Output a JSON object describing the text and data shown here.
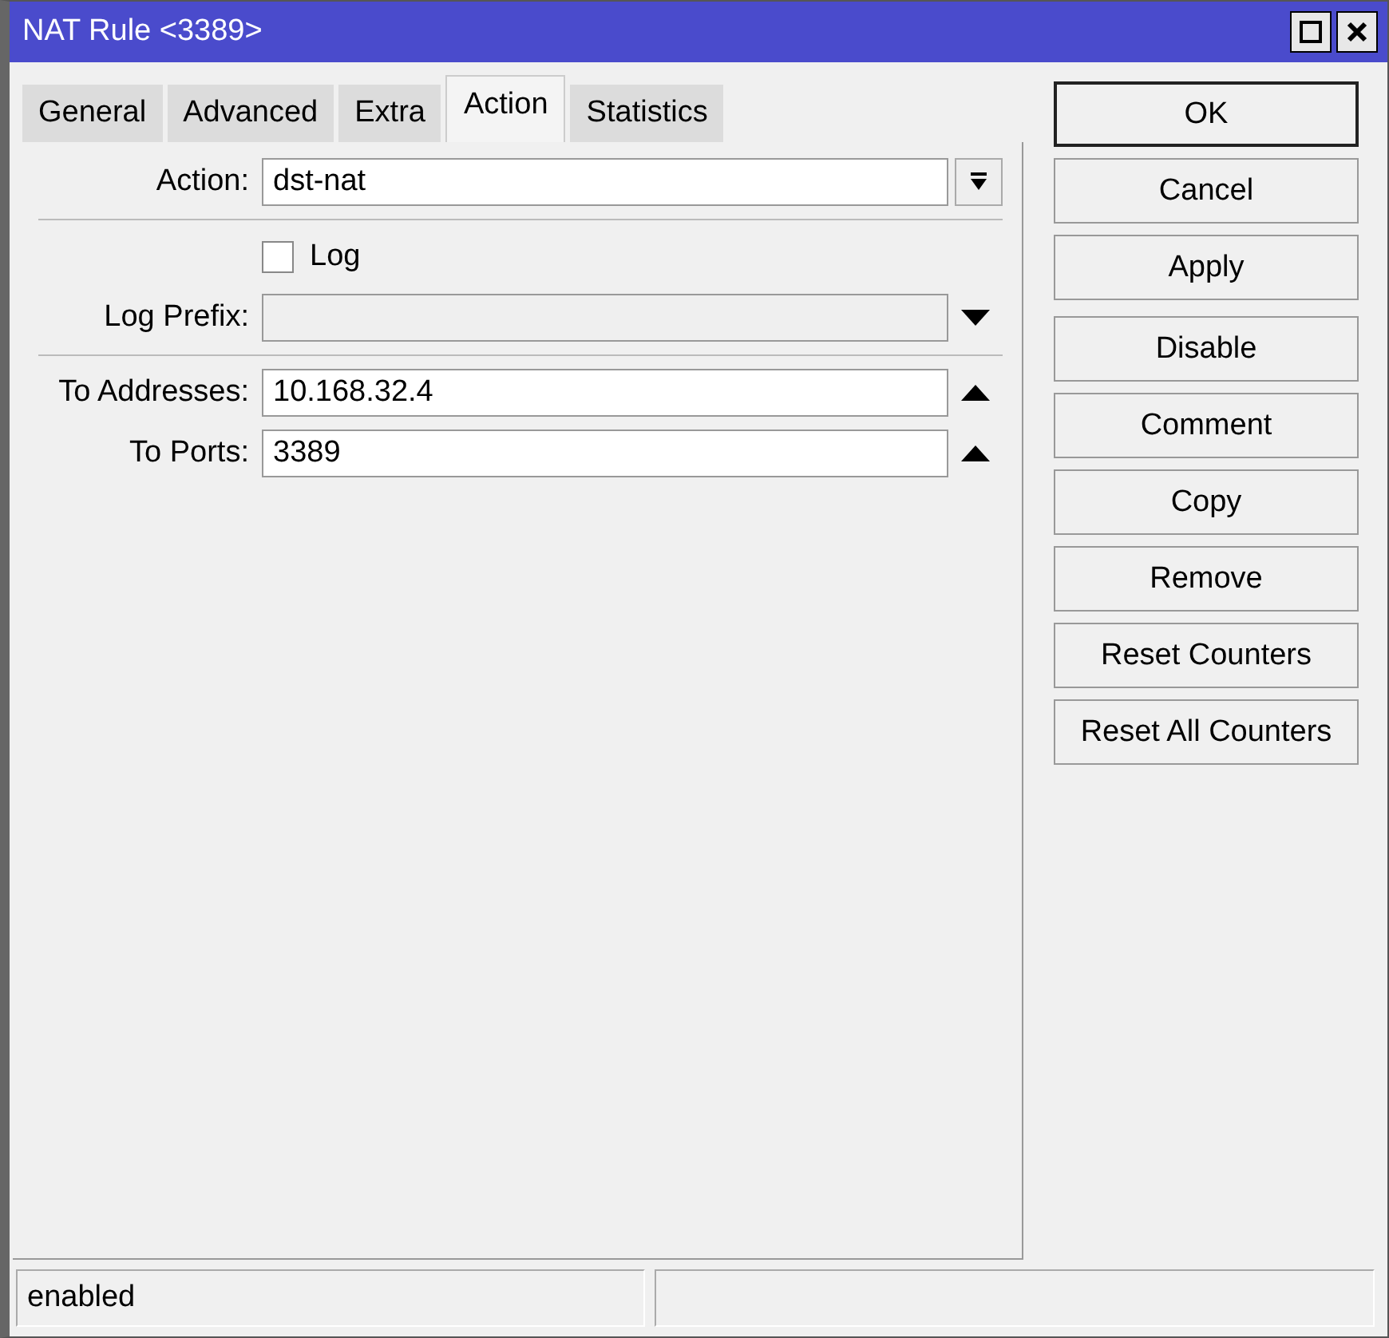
{
  "window": {
    "title": "NAT Rule <3389>"
  },
  "tabs": [
    {
      "label": "General",
      "selected": false
    },
    {
      "label": "Advanced",
      "selected": false
    },
    {
      "label": "Extra",
      "selected": false
    },
    {
      "label": "Action",
      "selected": true
    },
    {
      "label": "Statistics",
      "selected": false
    }
  ],
  "groups": [
    {
      "rows": [
        {
          "kind": "select",
          "label": "Action:",
          "value": "dst-nat"
        }
      ]
    },
    {
      "rows": [
        {
          "kind": "checkbox",
          "label": "Log",
          "checked": false
        },
        {
          "kind": "text",
          "label": "Log Prefix:",
          "disabled": true,
          "expanded": false
        }
      ]
    },
    {
      "rows": [
        {
          "kind": "text",
          "label": "To Addresses:",
          "value": "10.168.32.4",
          "disabled": false,
          "expanded": true
        },
        {
          "kind": "text",
          "label": "To Ports:",
          "value": "3389",
          "disabled": false,
          "expanded": true
        }
      ]
    }
  ],
  "button_groups": [
    [
      {
        "label": "OK",
        "default": true
      },
      {
        "label": "Cancel",
        "default": false
      },
      {
        "label": "Apply",
        "default": false
      }
    ],
    [
      {
        "label": "Disable",
        "default": false
      },
      {
        "label": "Comment",
        "default": false
      },
      {
        "label": "Copy",
        "default": false
      },
      {
        "label": "Remove",
        "default": false
      },
      {
        "label": "Reset Counters",
        "default": false
      },
      {
        "label": "Reset All Counters",
        "default": false
      }
    ]
  ],
  "status_bar": {
    "text": "enabled"
  }
}
